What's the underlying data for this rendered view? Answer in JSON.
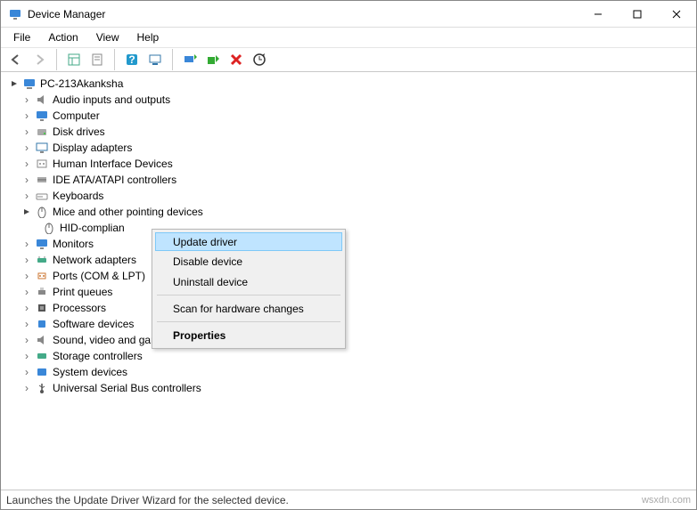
{
  "window": {
    "title": "Device Manager"
  },
  "menu": {
    "file": "File",
    "action": "Action",
    "view": "View",
    "help": "Help"
  },
  "tree": {
    "root": "PC-213Akanksha",
    "items": [
      "Audio inputs and outputs",
      "Computer",
      "Disk drives",
      "Display adapters",
      "Human Interface Devices",
      "IDE ATA/ATAPI controllers",
      "Keyboards",
      "Mice and other pointing devices",
      "Monitors",
      "Network adapters",
      "Ports (COM & LPT)",
      "Print queues",
      "Processors",
      "Software devices",
      "Sound, video and game controllers",
      "Storage controllers",
      "System devices",
      "Universal Serial Bus controllers"
    ],
    "selected_child": "HID-complian"
  },
  "context_menu": {
    "update": "Update driver",
    "disable": "Disable device",
    "uninstall": "Uninstall device",
    "scan": "Scan for hardware changes",
    "properties": "Properties"
  },
  "status": "Launches the Update Driver Wizard for the selected device.",
  "watermark": "wsxdn.com"
}
